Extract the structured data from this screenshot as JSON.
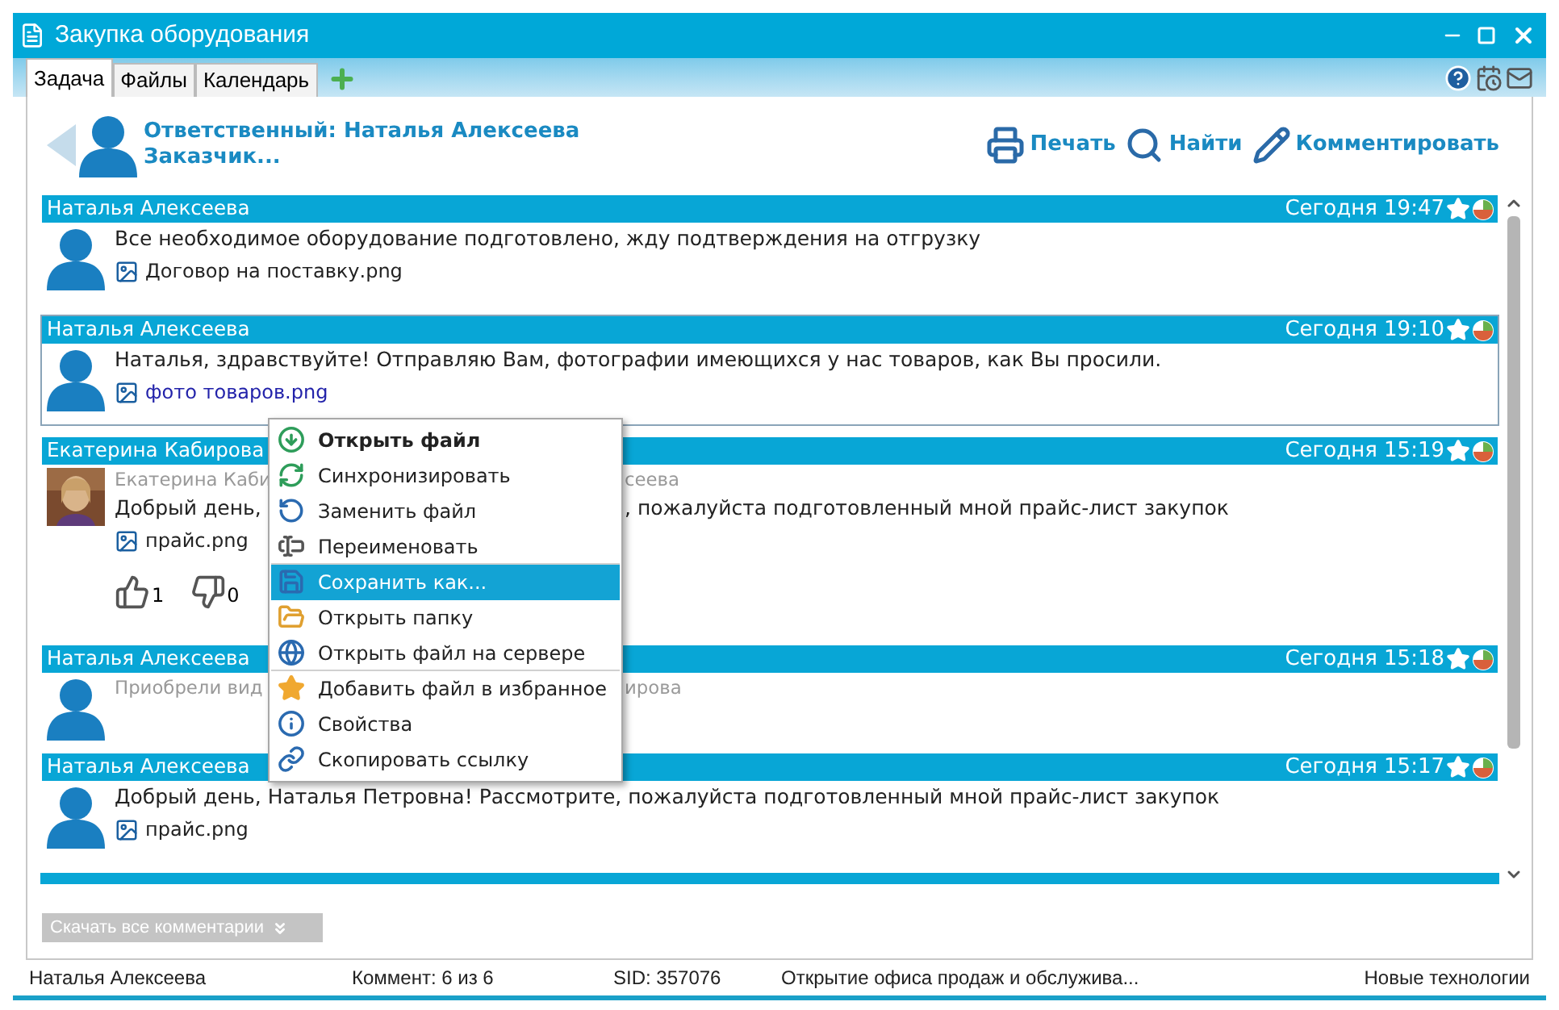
{
  "window": {
    "title": "Закупка оборудования"
  },
  "tabs": [
    {
      "label": "Задача",
      "selected": true
    },
    {
      "label": "Файлы",
      "selected": false
    },
    {
      "label": "Календарь",
      "selected": false
    }
  ],
  "header": {
    "responsible": "Ответственный: Наталья Алексеева",
    "customer": "Заказчик...",
    "actions": [
      {
        "kind": "print",
        "label": "Печать"
      },
      {
        "kind": "find",
        "label": "Найти"
      },
      {
        "kind": "comment",
        "label": "Комментировать"
      }
    ]
  },
  "comments": [
    {
      "author": "Наталья Алексеева",
      "time": "Сегодня 19:47",
      "kind": "silhouette",
      "selected": false,
      "text": "Все необходимое оборудование подготовлено, жду подтверждения на отгрузку",
      "attachment": {
        "name": "Договор на поставку.png",
        "link": false
      }
    },
    {
      "author": "Наталья Алексеева",
      "time": "Сегодня 19:10",
      "kind": "silhouette",
      "selected": true,
      "text": "Наталья, здравствуйте! Отправляю Вам, фотографии имеющихся у нас товаров, как Вы просили.",
      "attachment": {
        "name": "фото товаров.png",
        "link": true
      }
    },
    {
      "author": "Екатерина Кабирова",
      "time": "Сегодня 15:19",
      "selected": false,
      "quote_left": "Екатерина Каби",
      "quote_right": "сеева",
      "text_left": "Добрый день,",
      "text_right": ", пожалуйста подготовленный мной прайс-лист закупок",
      "attachment": {
        "name": "прайс.png",
        "link": false
      },
      "likes": "1",
      "dislikes": "0"
    },
    {
      "author": "Наталья Алексеева",
      "time": "Сегодня 15:18",
      "kind": "silhouette",
      "selected": false,
      "quote_left": "Приобрели вид",
      "quote_right": "ирова"
    },
    {
      "author": "Наталья Алексеева",
      "time": "Сегодня 15:17",
      "kind": "silhouette",
      "selected": false,
      "text": "Добрый день, Наталья Петровна! Рассмотрите, пожалуйста подготовленный мной прайс-лист закупок",
      "attachment": {
        "name": "прайс.png",
        "link": false
      }
    }
  ],
  "download_all": "Скачать все комментарии",
  "context_menu": [
    {
      "kind": "open",
      "label": "Открыть файл",
      "default": true,
      "selected": false,
      "separator_after": false
    },
    {
      "kind": "sync",
      "label": "Синхронизировать",
      "default": false,
      "selected": false,
      "separator_after": false
    },
    {
      "kind": "replace",
      "label": "Заменить файл",
      "default": false,
      "selected": false,
      "separator_after": false
    },
    {
      "kind": "rename",
      "label": "Переименовать",
      "default": false,
      "selected": false,
      "separator_after": true
    },
    {
      "kind": "save",
      "label": "Сохранить как...",
      "default": false,
      "selected": true,
      "separator_after": false
    },
    {
      "kind": "folder",
      "label": "Открыть папку",
      "default": false,
      "selected": false,
      "separator_after": false
    },
    {
      "kind": "server",
      "label": "Открыть файл на сервере",
      "default": false,
      "selected": false,
      "separator_after": true
    },
    {
      "kind": "favorite",
      "label": "Добавить файл в избранное",
      "default": false,
      "selected": false,
      "separator_after": false
    },
    {
      "kind": "properties",
      "label": "Свойства",
      "default": false,
      "selected": false,
      "separator_after": false
    },
    {
      "kind": "copylink",
      "label": "Скопировать ссылку",
      "default": false,
      "selected": false,
      "separator_after": false
    }
  ],
  "status_bar": [
    "Наталья Алексеева",
    "Коммент: 6 из 6",
    "SID: 357076",
    "Открытие офиса продаж и обслужива...",
    "Новые технологии"
  ]
}
